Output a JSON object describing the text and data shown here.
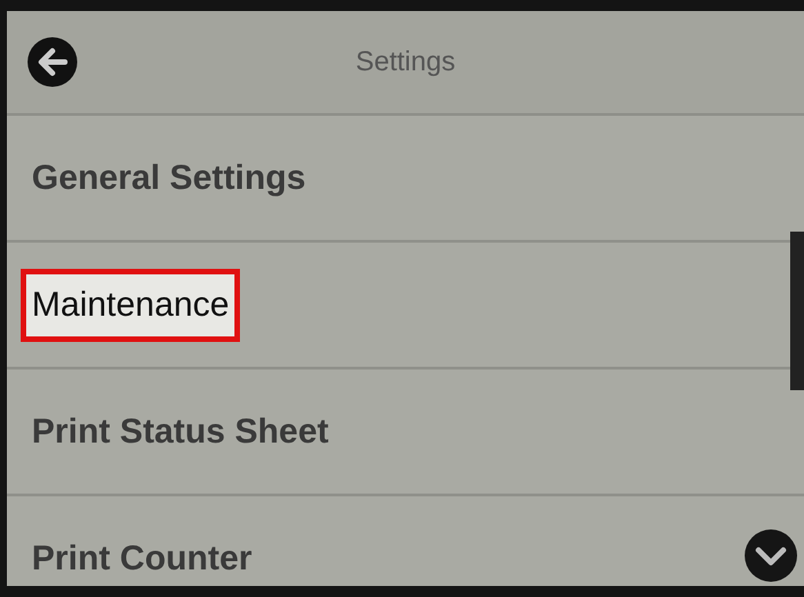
{
  "header": {
    "title": "Settings"
  },
  "items": [
    {
      "label": "General Settings",
      "highlighted": false
    },
    {
      "label": "Maintenance",
      "highlighted": true
    },
    {
      "label": "Print Status Sheet",
      "highlighted": false
    },
    {
      "label": "Print Counter",
      "highlighted": false
    }
  ]
}
